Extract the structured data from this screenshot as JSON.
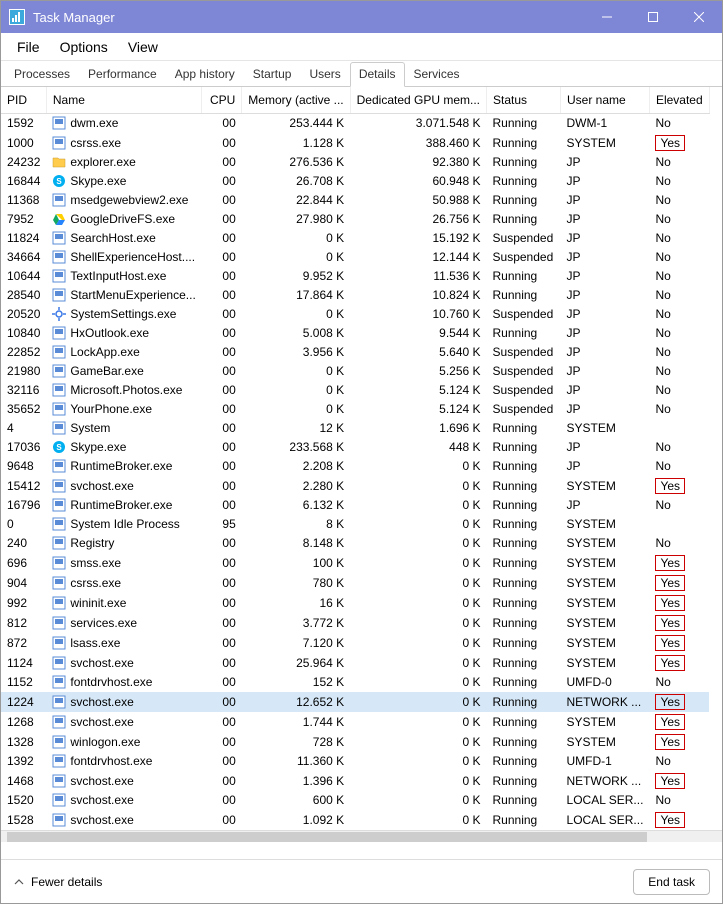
{
  "window": {
    "title": "Task Manager"
  },
  "menus": [
    "File",
    "Options",
    "View"
  ],
  "tabs": {
    "items": [
      "Processes",
      "Performance",
      "App history",
      "Startup",
      "Users",
      "Details",
      "Services"
    ],
    "active_index": 5
  },
  "columns": [
    {
      "key": "pid",
      "label": "PID",
      "align": "left",
      "cls": "col-pid"
    },
    {
      "key": "name",
      "label": "Name",
      "align": "left",
      "cls": "col-name"
    },
    {
      "key": "cpu",
      "label": "CPU",
      "align": "right",
      "cls": "col-cpu"
    },
    {
      "key": "memory",
      "label": "Memory (active ...",
      "align": "right",
      "cls": "col-mem"
    },
    {
      "key": "gpu",
      "label": "Dedicated GPU mem...",
      "align": "right",
      "cls": "col-gpu"
    },
    {
      "key": "status",
      "label": "Status",
      "align": "left",
      "cls": "col-status"
    },
    {
      "key": "user",
      "label": "User name",
      "align": "left",
      "cls": "col-user"
    },
    {
      "key": "elevated",
      "label": "Elevated",
      "align": "left",
      "cls": "col-elev"
    }
  ],
  "selected_pid": 1224,
  "footer": {
    "fewer_label": "Fewer details",
    "end_task_label": "End task"
  },
  "processes": [
    {
      "pid": 1592,
      "name": "dwm.exe",
      "icon": "app",
      "cpu": "00",
      "memory": "253.444 K",
      "gpu": "3.071.548 K",
      "status": "Running",
      "user": "DWM-1",
      "elevated": "No"
    },
    {
      "pid": 1000,
      "name": "csrss.exe",
      "icon": "app",
      "cpu": "00",
      "memory": "1.128 K",
      "gpu": "388.460 K",
      "status": "Running",
      "user": "SYSTEM",
      "elevated": "Yes"
    },
    {
      "pid": 24232,
      "name": "explorer.exe",
      "icon": "folder",
      "cpu": "00",
      "memory": "276.536 K",
      "gpu": "92.380 K",
      "status": "Running",
      "user": "JP",
      "elevated": "No"
    },
    {
      "pid": 16844,
      "name": "Skype.exe",
      "icon": "skype",
      "cpu": "00",
      "memory": "26.708 K",
      "gpu": "60.948 K",
      "status": "Running",
      "user": "JP",
      "elevated": "No"
    },
    {
      "pid": 11368,
      "name": "msedgewebview2.exe",
      "icon": "app",
      "cpu": "00",
      "memory": "22.844 K",
      "gpu": "50.988 K",
      "status": "Running",
      "user": "JP",
      "elevated": "No"
    },
    {
      "pid": 7952,
      "name": "GoogleDriveFS.exe",
      "icon": "gdrive",
      "cpu": "00",
      "memory": "27.980 K",
      "gpu": "26.756 K",
      "status": "Running",
      "user": "JP",
      "elevated": "No"
    },
    {
      "pid": 11824,
      "name": "SearchHost.exe",
      "icon": "app",
      "cpu": "00",
      "memory": "0 K",
      "gpu": "15.192 K",
      "status": "Suspended",
      "user": "JP",
      "elevated": "No"
    },
    {
      "pid": 34664,
      "name": "ShellExperienceHost....",
      "icon": "app",
      "cpu": "00",
      "memory": "0 K",
      "gpu": "12.144 K",
      "status": "Suspended",
      "user": "JP",
      "elevated": "No"
    },
    {
      "pid": 10644,
      "name": "TextInputHost.exe",
      "icon": "app",
      "cpu": "00",
      "memory": "9.952 K",
      "gpu": "11.536 K",
      "status": "Running",
      "user": "JP",
      "elevated": "No"
    },
    {
      "pid": 28540,
      "name": "StartMenuExperience...",
      "icon": "app",
      "cpu": "00",
      "memory": "17.864 K",
      "gpu": "10.824 K",
      "status": "Running",
      "user": "JP",
      "elevated": "No"
    },
    {
      "pid": 20520,
      "name": "SystemSettings.exe",
      "icon": "settings",
      "cpu": "00",
      "memory": "0 K",
      "gpu": "10.760 K",
      "status": "Suspended",
      "user": "JP",
      "elevated": "No"
    },
    {
      "pid": 10840,
      "name": "HxOutlook.exe",
      "icon": "app",
      "cpu": "00",
      "memory": "5.008 K",
      "gpu": "9.544 K",
      "status": "Running",
      "user": "JP",
      "elevated": "No"
    },
    {
      "pid": 22852,
      "name": "LockApp.exe",
      "icon": "app",
      "cpu": "00",
      "memory": "3.956 K",
      "gpu": "5.640 K",
      "status": "Suspended",
      "user": "JP",
      "elevated": "No"
    },
    {
      "pid": 21980,
      "name": "GameBar.exe",
      "icon": "app",
      "cpu": "00",
      "memory": "0 K",
      "gpu": "5.256 K",
      "status": "Suspended",
      "user": "JP",
      "elevated": "No"
    },
    {
      "pid": 32116,
      "name": "Microsoft.Photos.exe",
      "icon": "app",
      "cpu": "00",
      "memory": "0 K",
      "gpu": "5.124 K",
      "status": "Suspended",
      "user": "JP",
      "elevated": "No"
    },
    {
      "pid": 35652,
      "name": "YourPhone.exe",
      "icon": "app",
      "cpu": "00",
      "memory": "0 K",
      "gpu": "5.124 K",
      "status": "Suspended",
      "user": "JP",
      "elevated": "No"
    },
    {
      "pid": 4,
      "name": "System",
      "icon": "app",
      "cpu": "00",
      "memory": "12 K",
      "gpu": "1.696 K",
      "status": "Running",
      "user": "SYSTEM",
      "elevated": ""
    },
    {
      "pid": 17036,
      "name": "Skype.exe",
      "icon": "skype",
      "cpu": "00",
      "memory": "233.568 K",
      "gpu": "448 K",
      "status": "Running",
      "user": "JP",
      "elevated": "No"
    },
    {
      "pid": 9648,
      "name": "RuntimeBroker.exe",
      "icon": "app",
      "cpu": "00",
      "memory": "2.208 K",
      "gpu": "0 K",
      "status": "Running",
      "user": "JP",
      "elevated": "No"
    },
    {
      "pid": 15412,
      "name": "svchost.exe",
      "icon": "app",
      "cpu": "00",
      "memory": "2.280 K",
      "gpu": "0 K",
      "status": "Running",
      "user": "SYSTEM",
      "elevated": "Yes"
    },
    {
      "pid": 16796,
      "name": "RuntimeBroker.exe",
      "icon": "app",
      "cpu": "00",
      "memory": "6.132 K",
      "gpu": "0 K",
      "status": "Running",
      "user": "JP",
      "elevated": "No"
    },
    {
      "pid": 0,
      "name": "System Idle Process",
      "icon": "app",
      "cpu": "95",
      "memory": "8 K",
      "gpu": "0 K",
      "status": "Running",
      "user": "SYSTEM",
      "elevated": ""
    },
    {
      "pid": 240,
      "name": "Registry",
      "icon": "app",
      "cpu": "00",
      "memory": "8.148 K",
      "gpu": "0 K",
      "status": "Running",
      "user": "SYSTEM",
      "elevated": "No"
    },
    {
      "pid": 696,
      "name": "smss.exe",
      "icon": "app",
      "cpu": "00",
      "memory": "100 K",
      "gpu": "0 K",
      "status": "Running",
      "user": "SYSTEM",
      "elevated": "Yes"
    },
    {
      "pid": 904,
      "name": "csrss.exe",
      "icon": "app",
      "cpu": "00",
      "memory": "780 K",
      "gpu": "0 K",
      "status": "Running",
      "user": "SYSTEM",
      "elevated": "Yes"
    },
    {
      "pid": 992,
      "name": "wininit.exe",
      "icon": "app",
      "cpu": "00",
      "memory": "16 K",
      "gpu": "0 K",
      "status": "Running",
      "user": "SYSTEM",
      "elevated": "Yes"
    },
    {
      "pid": 812,
      "name": "services.exe",
      "icon": "app",
      "cpu": "00",
      "memory": "3.772 K",
      "gpu": "0 K",
      "status": "Running",
      "user": "SYSTEM",
      "elevated": "Yes"
    },
    {
      "pid": 872,
      "name": "lsass.exe",
      "icon": "app",
      "cpu": "00",
      "memory": "7.120 K",
      "gpu": "0 K",
      "status": "Running",
      "user": "SYSTEM",
      "elevated": "Yes"
    },
    {
      "pid": 1124,
      "name": "svchost.exe",
      "icon": "app",
      "cpu": "00",
      "memory": "25.964 K",
      "gpu": "0 K",
      "status": "Running",
      "user": "SYSTEM",
      "elevated": "Yes"
    },
    {
      "pid": 1152,
      "name": "fontdrvhost.exe",
      "icon": "app",
      "cpu": "00",
      "memory": "152 K",
      "gpu": "0 K",
      "status": "Running",
      "user": "UMFD-0",
      "elevated": "No"
    },
    {
      "pid": 1224,
      "name": "svchost.exe",
      "icon": "app",
      "cpu": "00",
      "memory": "12.652 K",
      "gpu": "0 K",
      "status": "Running",
      "user": "NETWORK ...",
      "elevated": "Yes"
    },
    {
      "pid": 1268,
      "name": "svchost.exe",
      "icon": "app",
      "cpu": "00",
      "memory": "1.744 K",
      "gpu": "0 K",
      "status": "Running",
      "user": "SYSTEM",
      "elevated": "Yes"
    },
    {
      "pid": 1328,
      "name": "winlogon.exe",
      "icon": "app",
      "cpu": "00",
      "memory": "728 K",
      "gpu": "0 K",
      "status": "Running",
      "user": "SYSTEM",
      "elevated": "Yes"
    },
    {
      "pid": 1392,
      "name": "fontdrvhost.exe",
      "icon": "app",
      "cpu": "00",
      "memory": "11.360 K",
      "gpu": "0 K",
      "status": "Running",
      "user": "UMFD-1",
      "elevated": "No"
    },
    {
      "pid": 1468,
      "name": "svchost.exe",
      "icon": "app",
      "cpu": "00",
      "memory": "1.396 K",
      "gpu": "0 K",
      "status": "Running",
      "user": "NETWORK ...",
      "elevated": "Yes"
    },
    {
      "pid": 1520,
      "name": "svchost.exe",
      "icon": "app",
      "cpu": "00",
      "memory": "600 K",
      "gpu": "0 K",
      "status": "Running",
      "user": "LOCAL SER...",
      "elevated": "No"
    },
    {
      "pid": 1528,
      "name": "svchost.exe",
      "icon": "app",
      "cpu": "00",
      "memory": "1.092 K",
      "gpu": "0 K",
      "status": "Running",
      "user": "LOCAL SER...",
      "elevated": "Yes"
    }
  ]
}
